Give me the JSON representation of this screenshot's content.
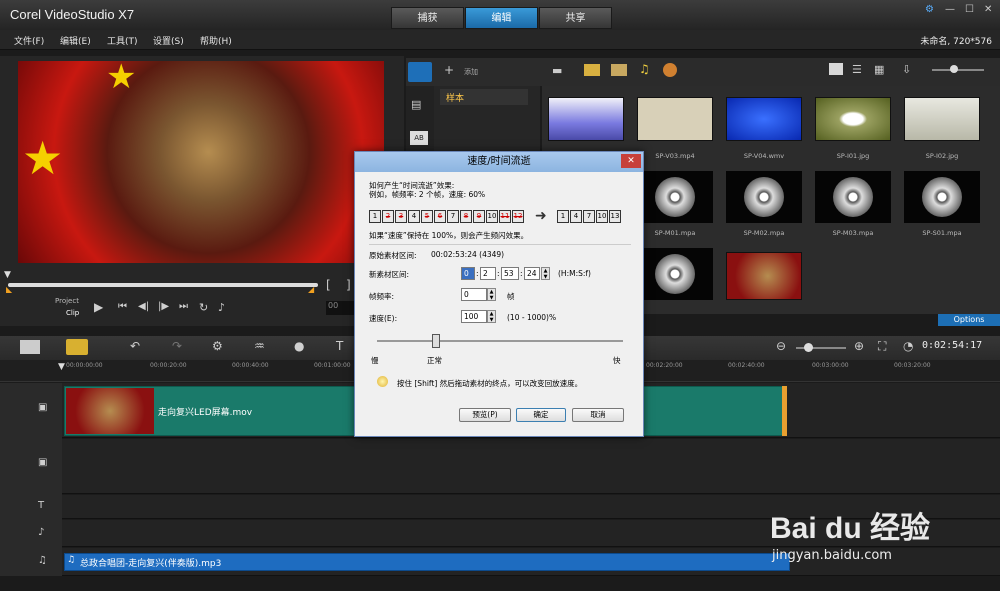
{
  "app": {
    "title": "Corel VideoStudio X7",
    "tabs": [
      "捕获",
      "编辑",
      "共享"
    ],
    "active_tab": "编辑",
    "window_buttons": [
      "⚙",
      "—",
      "☐",
      "✕"
    ]
  },
  "menu": {
    "items": [
      "文件(F)",
      "编辑(E)",
      "工具(T)",
      "设置(S)",
      "帮助(H)"
    ],
    "project_info": "未命名, 720*576"
  },
  "player": {
    "project_label": "Project",
    "clip_label": "Clip"
  },
  "library": {
    "add_label": "添加",
    "sample_label": "样本",
    "options_label": "Options",
    "thumbs": [
      {
        "label": "",
        "kind": "video",
        "color": "#7a7ae0"
      },
      {
        "label": "",
        "kind": "video",
        "color": "#d8d0b8"
      },
      {
        "label": "",
        "kind": "video",
        "color": "#1240d0"
      },
      {
        "label": "",
        "kind": "image",
        "color": "#9aa060"
      },
      {
        "label": "",
        "kind": "image",
        "color": "#d0d0c0"
      },
      {
        "label": "",
        "kind": "video",
        "color": "#aaa"
      },
      {
        "label": "SP-V03.mp4",
        "kind": "label"
      },
      {
        "label": "SP-V04.wmv",
        "kind": "label"
      },
      {
        "label": "SP-I01.jpg",
        "kind": "label"
      },
      {
        "label": "SP-I02.jpg",
        "kind": "label"
      }
    ],
    "audio_labels": [
      "SP-M01.mpa",
      "SP-M02.mpa",
      "SP-M03.mpa",
      "SP-S01.mpa"
    ]
  },
  "timeline": {
    "time_display": "0:02:54:17",
    "ruler": [
      "00:00:00:00",
      "00:00:20:00",
      "00:00:40:00",
      "00:01:00:00",
      "00:02:20:00",
      "00:02:40:00",
      "00:03:00:00",
      "00:03:20:00"
    ],
    "video_clip": "走向复兴LED屏幕.mov",
    "audio_clip": "总政合唱团-走向复兴(伴奏版).mp3"
  },
  "dialog": {
    "title": "速度/时间流逝",
    "line1": "如何产生“时间流逝”效果:",
    "line2": "例如，帧频率: 2 个帧，速度: 60%",
    "frames_before": [
      "1",
      "2",
      "3",
      "4",
      "5",
      "6",
      "7",
      "8",
      "9",
      "10",
      "11",
      "12"
    ],
    "frames_before_crossed": [
      false,
      true,
      true,
      false,
      true,
      true,
      false,
      true,
      true,
      false,
      true,
      true
    ],
    "frames_after": [
      "1",
      "4",
      "7",
      "10",
      "13"
    ],
    "note": "如果“速度”保持在 100%，则会产生频闪效果。",
    "original_label": "原始素材区间:",
    "original_value": "00:02:53:24 (4349)",
    "new_label": "新素材区间:",
    "new_h": "0",
    "new_m": "2",
    "new_s": "53",
    "new_f": "24",
    "new_format": "(H:M:S:f)",
    "frame_rate_label": "帧频率:",
    "frame_rate_value": "0",
    "frame_rate_unit": "帧",
    "speed_label": "速度(E):",
    "speed_value": "100",
    "speed_range": "(10 - 1000)%",
    "slow_label": "慢",
    "normal_label": "正常",
    "fast_label": "快",
    "tip": "按住 [Shift] 然后拖动素材的终点，可以改变回放速度。",
    "preview_button": "预览(P)",
    "ok_button": "确定",
    "cancel_button": "取消"
  },
  "watermark": {
    "brand": "Bai du 经验",
    "url": "jingyan.baidu.com"
  }
}
